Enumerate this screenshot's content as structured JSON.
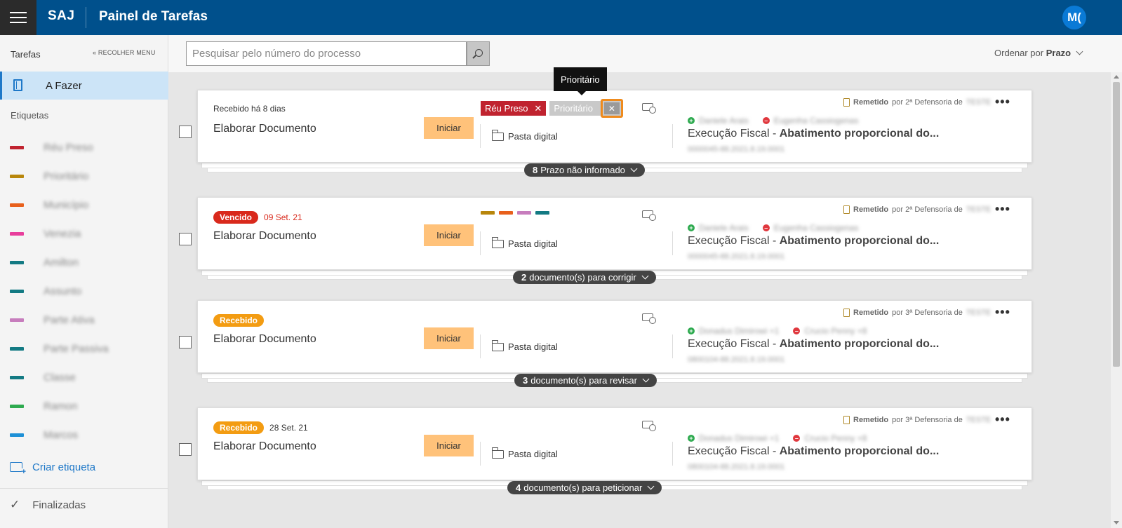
{
  "header": {
    "brand": "SAJ",
    "title": "Painel de Tarefas",
    "avatar": "M("
  },
  "sidebar": {
    "title": "Tarefas",
    "collapse_label": "RECOLHER MENU",
    "active_item": "A Fazer",
    "section_label": "Etiquetas",
    "tags": [
      {
        "name": "Réu Preso",
        "color": "#c0232f"
      },
      {
        "name": "Prioritário",
        "color": "#b8860b"
      },
      {
        "name": "Município",
        "color": "#e8601c"
      },
      {
        "name": "Venezia",
        "color": "#e83e9c"
      },
      {
        "name": "Amilton",
        "color": "#137a83"
      },
      {
        "name": "Assunto",
        "color": "#137a83"
      },
      {
        "name": "Parte Ativa",
        "color": "#c77dbd"
      },
      {
        "name": "Parte Passiva",
        "color": "#137a83"
      },
      {
        "name": "Classe",
        "color": "#137a83"
      },
      {
        "name": "Ramon",
        "color": "#2eaa4f"
      },
      {
        "name": "Marcos",
        "color": "#1e90d6"
      }
    ],
    "create_tag": "Criar etiqueta",
    "finalizadas": "Finalizadas"
  },
  "search": {
    "placeholder": "Pesquisar pelo número do processo",
    "value": ""
  },
  "sort": {
    "label": "Ordenar por",
    "value": "Prazo"
  },
  "tooltip": "Prioritário",
  "cards": [
    {
      "status_text": "Recebido há 8 dias",
      "title": "Elaborar Documento",
      "action": "Iniciar",
      "tag1": "Réu Preso",
      "tag2": "Prioritário",
      "folder": "Pasta digital",
      "remetido": "Remetido",
      "remetido_by": "por 2ª Defensoria de",
      "remetido_blur": "TESTE",
      "party_active": "Daniele Arais",
      "party_passive": "Eugenha Cassiogenas",
      "proc_class": "Execução Fiscal - ",
      "proc_subject": "Abatimento proporcional do...",
      "proc_number": "0000045-88.2021.8.19.0001",
      "pill_count": "8",
      "pill_text": "Prazo não informado"
    },
    {
      "badge": "Vencido",
      "date": "09 Set. 21",
      "title": "Elaborar Documento",
      "action": "Iniciar",
      "mini_tags": [
        "#b8860b",
        "#e8601c",
        "#c77dbd",
        "#137a83"
      ],
      "folder": "Pasta digital",
      "remetido": "Remetido",
      "remetido_by": "por 2ª Defensoria de",
      "remetido_blur": "TESTE",
      "party_active": "Daniele Arais",
      "party_passive": "Eugenha Cassiogenas",
      "proc_class": "Execução Fiscal - ",
      "proc_subject": "Abatimento proporcional do...",
      "proc_number": "0000045-88.2021.8.19.0001",
      "pill_count": "2",
      "pill_text": "documento(s) para corrigir"
    },
    {
      "badge": "Recebido",
      "title": "Elaborar Documento",
      "action": "Iniciar",
      "folder": "Pasta digital",
      "remetido": "Remetido",
      "remetido_by": "por 3ª Defensoria de",
      "remetido_blur": "TESTE",
      "party_active": "Donadus Dimirowi +1",
      "party_passive": "Crucio Penny +8",
      "proc_class": "Execução Fiscal - ",
      "proc_subject": "Abatimento proporcional do...",
      "proc_number": "0800104-88.2021.8.19.0001",
      "pill_count": "3",
      "pill_text": "documento(s) para revisar"
    },
    {
      "badge": "Recebido",
      "date": "28 Set. 21",
      "title": "Elaborar Documento",
      "action": "Iniciar",
      "folder": "Pasta digital",
      "remetido": "Remetido",
      "remetido_by": "por 3ª Defensoria de",
      "remetido_blur": "TESTE",
      "party_active": "Donadus Dimirowi +1",
      "party_passive": "Crucio Penny +8",
      "proc_class": "Execução Fiscal - ",
      "proc_subject": "Abatimento proporcional do...",
      "proc_number": "0800104-88.2021.8.19.0001",
      "pill_count": "4",
      "pill_text": "documento(s) para peticionar"
    }
  ]
}
